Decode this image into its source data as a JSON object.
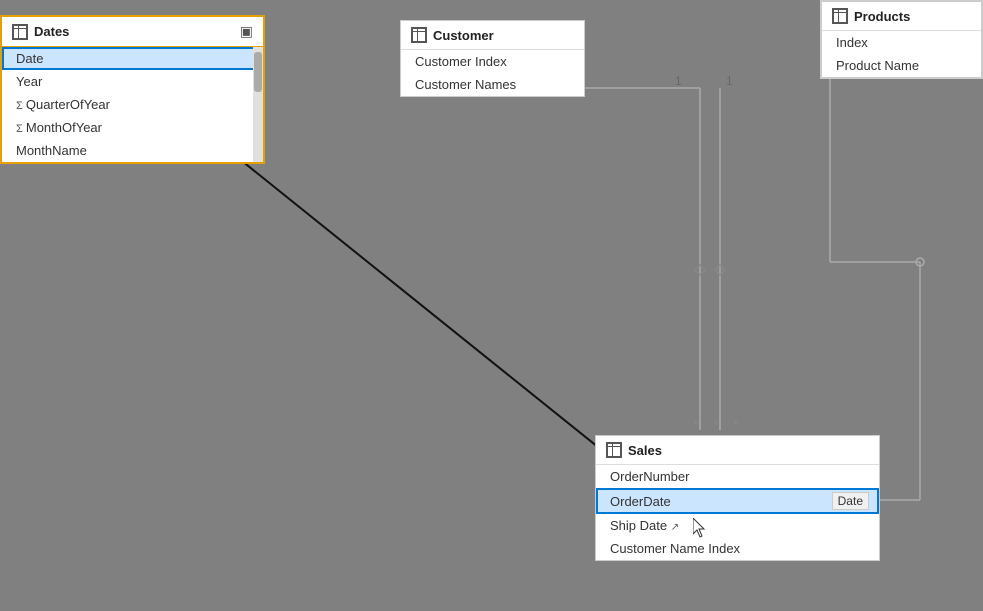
{
  "dates": {
    "title": "Dates",
    "fields": [
      {
        "name": "Date",
        "type": "plain",
        "selected": true
      },
      {
        "name": "Year",
        "type": "plain"
      },
      {
        "name": "QuarterOfYear",
        "type": "sigma"
      },
      {
        "name": "MonthOfYear",
        "type": "sigma"
      },
      {
        "name": "MonthName",
        "type": "plain"
      }
    ]
  },
  "customer": {
    "title": "Customer",
    "fields": [
      {
        "name": "Customer Index"
      },
      {
        "name": "Customer Names"
      }
    ]
  },
  "products": {
    "title": "Products",
    "fields": [
      {
        "name": "Index"
      },
      {
        "name": "Product Name"
      }
    ]
  },
  "sales": {
    "title": "Sales",
    "fields": [
      {
        "name": "OrderNumber",
        "type": "plain"
      },
      {
        "name": "OrderDate",
        "type": "selected"
      },
      {
        "name": "Ship Date",
        "type": "plain"
      },
      {
        "name": "Customer Name Index",
        "type": "plain"
      }
    ]
  },
  "tooltip": {
    "text": "Date"
  }
}
